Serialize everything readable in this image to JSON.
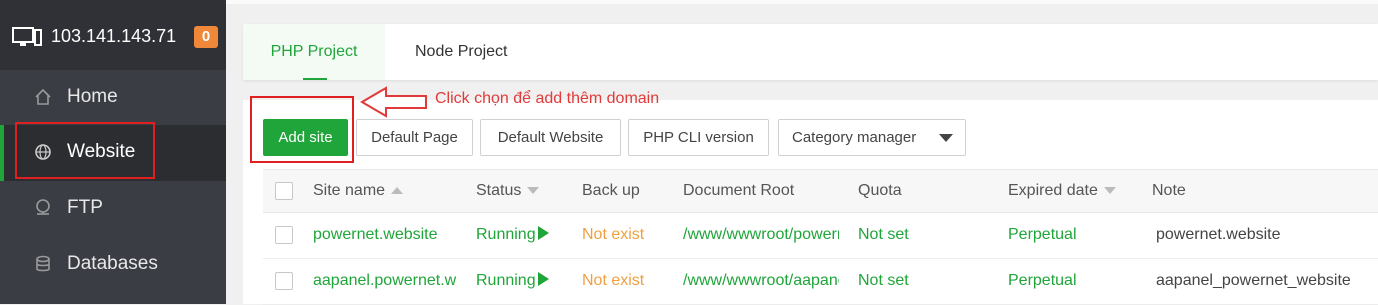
{
  "server": {
    "ip": "103.141.143.71",
    "badge": "0"
  },
  "sidebar": {
    "items": [
      {
        "label": "Home",
        "icon": "home-icon"
      },
      {
        "label": "Website",
        "icon": "globe-icon",
        "active": true
      },
      {
        "label": "FTP",
        "icon": "ftp-icon"
      },
      {
        "label": "Databases",
        "icon": "database-icon"
      }
    ]
  },
  "tabs": [
    {
      "label": "PHP Project",
      "active": true
    },
    {
      "label": "Node Project"
    }
  ],
  "annotation": "Click chọn để add thêm domain",
  "toolbar": {
    "add_site": "Add site",
    "default_page": "Default Page",
    "default_website": "Default Website",
    "php_cli": "PHP CLI version",
    "category": "Category manager"
  },
  "table": {
    "headers": [
      "Site name",
      "Status",
      "Back up",
      "Document Root",
      "Quota",
      "Expired date",
      "Note"
    ],
    "rows": [
      {
        "site": "powernet.website",
        "status": "Running",
        "backup": "Not exist",
        "root": "/www/wwwroot/powernet.website",
        "quota": "Not set",
        "expired": "Perpetual",
        "note": "powernet.website"
      },
      {
        "site": "aapanel.powernet.website",
        "status": "Running",
        "backup": "Not exist",
        "root": "/www/wwwroot/aapanel.powernet.website",
        "quota": "Not set",
        "expired": "Perpetual",
        "note": "aapanel_powernet_website"
      }
    ]
  },
  "colors": {
    "accent": "#20a53a",
    "sidebar": "#3a3d44",
    "annotation": "#e03a3a",
    "warning": "#f0a040"
  }
}
